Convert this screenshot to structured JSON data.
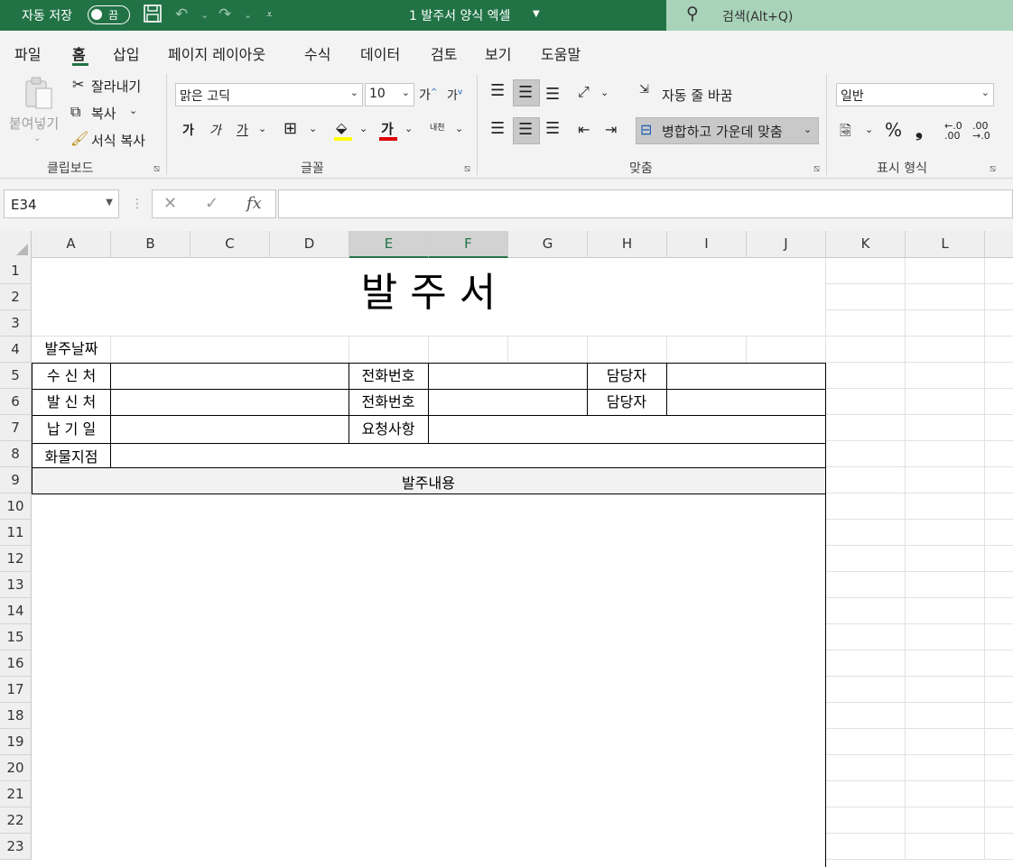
{
  "titlebar": {
    "autosave_label": "자동 저장",
    "autosave_state": "끔",
    "file_title": "1 발주서 양식 엑셀",
    "search_placeholder": "검색(Alt+Q)"
  },
  "ribbon_tabs": [
    "파일",
    "홈",
    "삽입",
    "페이지 레이아웃",
    "수식",
    "데이터",
    "검토",
    "보기",
    "도움말"
  ],
  "active_tab": "홈",
  "clipboard": {
    "paste": "붙여넣기",
    "cut": "잘라내기",
    "copy": "복사",
    "format_painter": "서식 복사",
    "group": "클립보드"
  },
  "font": {
    "name": "맑은 고딕",
    "size": "10",
    "bold": "가",
    "italic": "가",
    "underline": "가",
    "color_glyph": "가",
    "phonetic": "내천",
    "group": "글꼴"
  },
  "alignment": {
    "wrap_text": "자동 줄 바꿈",
    "merge_center": "병합하고 가운데 맞춤",
    "group": "맞춤"
  },
  "number": {
    "format": "일반",
    "group": "표시 형식"
  },
  "formula_bar": {
    "name_box": "E34",
    "formula": ""
  },
  "columns": [
    "A",
    "B",
    "C",
    "D",
    "E",
    "F",
    "G",
    "H",
    "I",
    "J",
    "K",
    "L"
  ],
  "rows": [
    "1",
    "2",
    "3",
    "4",
    "5",
    "6",
    "7",
    "8",
    "9",
    "10",
    "11",
    "12",
    "13",
    "14",
    "15",
    "16",
    "17",
    "18",
    "19",
    "20",
    "21",
    "22",
    "23"
  ],
  "form": {
    "title": "발 주 서",
    "order_date": "발주날짜",
    "recipient": "수 신 처",
    "sender": "발 신 처",
    "delivery_date": "납 기 일",
    "cargo_branch": "화물지점",
    "phone_1": "전화번호",
    "phone_2": "전화번호",
    "request": "요청사항",
    "manager_1": "담당자",
    "manager_2": "담당자",
    "order_details": "발주내용"
  },
  "colors": {
    "excel_green": "#217346",
    "search_bg": "#a8d3b9",
    "ribbon_bg": "#f3f3f3"
  }
}
